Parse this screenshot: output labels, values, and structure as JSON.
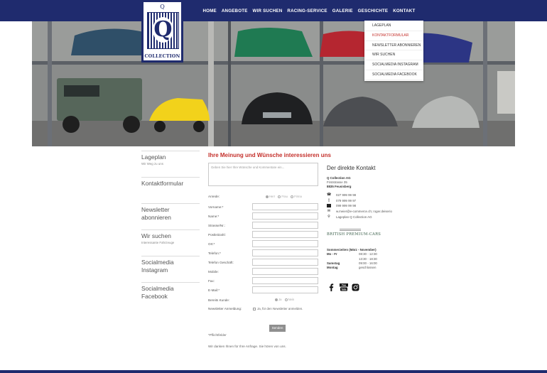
{
  "nav": {
    "items": [
      "HOME",
      "ANGEBOTE",
      "WIR SUCHEN",
      "RACING-SERVICE",
      "GALERIE",
      "GESCHICHTE",
      "KONTAKT"
    ]
  },
  "logo": {
    "crown": "Q",
    "letter": "Q",
    "text": "COLLECTION"
  },
  "dropdown": {
    "items": [
      "LAGEPLAN",
      "KONTAKTFORMULAR",
      "NEWSLETTER ABONNIEREN",
      "WIR SUCHEN",
      "SOCIALMEDIA INSTAGRAM",
      "SOCIALMEDIA FACEBOOK"
    ],
    "active_index": 1
  },
  "slider": {
    "dot_count": 7,
    "active_dot": 0
  },
  "sidebar": {
    "items": [
      {
        "title": "Lageplan",
        "sub": "Wir Weg zu uns"
      },
      {
        "title": "Kontaktformular",
        "sub": ""
      },
      {
        "title": "Newsletter abonnieren",
        "sub": ""
      },
      {
        "title": "Wir suchen",
        "sub": "Interessante Fahrzeuge"
      },
      {
        "title": "Socialmedia Instagram",
        "sub": ""
      },
      {
        "title": "Socialmedia Facebook",
        "sub": ""
      }
    ]
  },
  "form": {
    "title": "Ihre Meinung und Wünsche interessieren uns",
    "textarea_placeholder": "Geben Sie hier Ihre Wünsche und Kommentare ein...",
    "anrede_label": "Anrede:",
    "anrede_options": [
      "Herr",
      "Frau",
      "Firma"
    ],
    "fields": [
      "Vorname:*",
      "Name:*",
      "Strasse/Nr.:",
      "Postleitzahl:",
      "Ort:*",
      "Telefon:*",
      "Telefon Geschäft:",
      "Mobile:",
      "Fax:",
      "E-Mail:*"
    ],
    "kunde_label": "Bereits Kunde:",
    "kunde_options": [
      "Ja",
      "Nein"
    ],
    "newsletter_label": "Newsletter Anmeldung:",
    "newsletter_text": "Ja, für den Newsletter anmelden.",
    "submit": "Senden",
    "required_note": "*Pflichtfelder",
    "thanks": "Wir danken Ihnen für Ihre Anfrage. Sie hören von uns."
  },
  "contact": {
    "title": "Der direkte Kontakt",
    "company": "Q Collection AG",
    "street": "Firststrasse 35",
    "city": "8835  Feusisberg",
    "phone": "027 999 99 98",
    "mobile": "079 999 99 97",
    "fax": "099 999 99 98",
    "email": "w.meier@e-commerce.ch; roger.deiserio",
    "map": "Lageplan Q Collection AG",
    "brand": "BRITISH PREMIUM-CARS",
    "hours_title": "Sommerzeiten  (März - November)",
    "hours": [
      {
        "day": "Mo - Fr",
        "time": "08:30 - 12:30"
      },
      {
        "day": "",
        "time": "13:30 - 18:30"
      },
      {
        "day": "Samstag",
        "time": "09:00 - 16:00"
      },
      {
        "day": "Montag",
        "time": "geschlossen"
      }
    ]
  },
  "colors": {
    "navy": "#1f2b6e",
    "accent_red": "#c4302b"
  }
}
